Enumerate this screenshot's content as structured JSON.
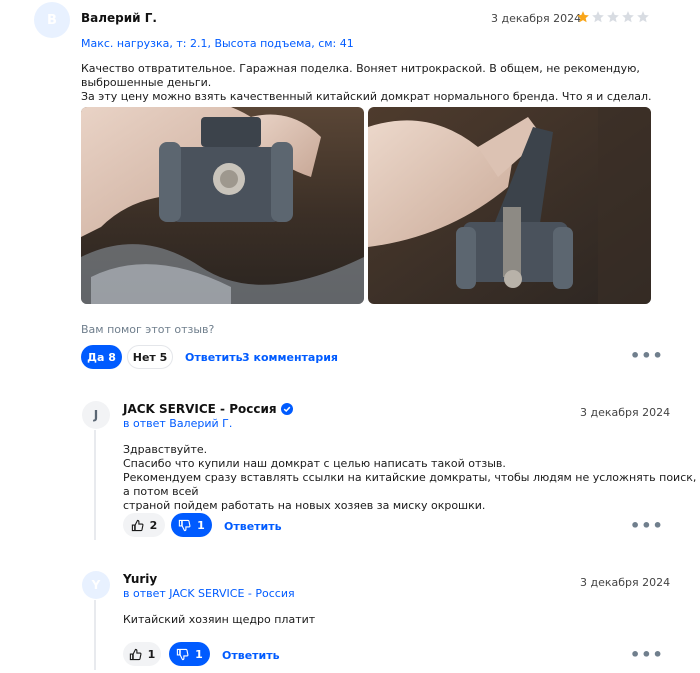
{
  "review": {
    "avatar_letter": "В",
    "author": "Валерий Г.",
    "date": "3 декабря 2024",
    "rating": 1,
    "rating_max": 5,
    "params": "Макс. нагрузка, т: 2.1, Высота подъема, см: 41",
    "text_line1": "Качество отвратительное. Гаражная поделка. Воняет нитрокраской. В общем, не рекомендую, выброшенные деньги.",
    "text_line2": "За эту цену можно взять качественный китайский домкрат нормального бренда. Что я и сделал.",
    "helpful_question": "Вам помог этот отзыв?",
    "yes_label": "Да 8",
    "no_label": "Нет 5",
    "reply_label": "Ответить",
    "comments_label": "3 комментария"
  },
  "comments": [
    {
      "avatar_letter": "J",
      "author": "JACK SERVICE - Россия",
      "verified": true,
      "in_reply": "в ответ Валерий Г.",
      "date": "3 декабря 2024",
      "lines": [
        "Здравствуйте.",
        "Спасибо что купили наш домкрат с целью написать такой отзыв.",
        "Рекомендуем сразу вставлять ссылки на китайские домкраты, чтобы людям не усложнять поиск, а потом всей",
        "страной пойдем работать на новых хозяев за миску окрошки."
      ],
      "likes": "2",
      "dislikes": "1",
      "reply_label": "Ответить"
    },
    {
      "avatar_letter": "Y",
      "author": "Yuriy",
      "in_reply": "в ответ JACK SERVICE - Россия",
      "date": "3 декабря 2024",
      "lines": [
        "Китайский хозяин щедро платит"
      ],
      "likes": "1",
      "dislikes": "1",
      "reply_label": "Ответить"
    }
  ],
  "colors": {
    "accent": "#005bff",
    "star_filled": "#f9a61a",
    "star_empty": "#d8dce2",
    "avatar_bg": "#e8f1ff"
  },
  "icons": {
    "more": "more-dots-icon",
    "like": "thumbs-up-icon",
    "dislike": "thumbs-down-icon",
    "verified": "verified-check-icon",
    "star": "star-icon"
  }
}
